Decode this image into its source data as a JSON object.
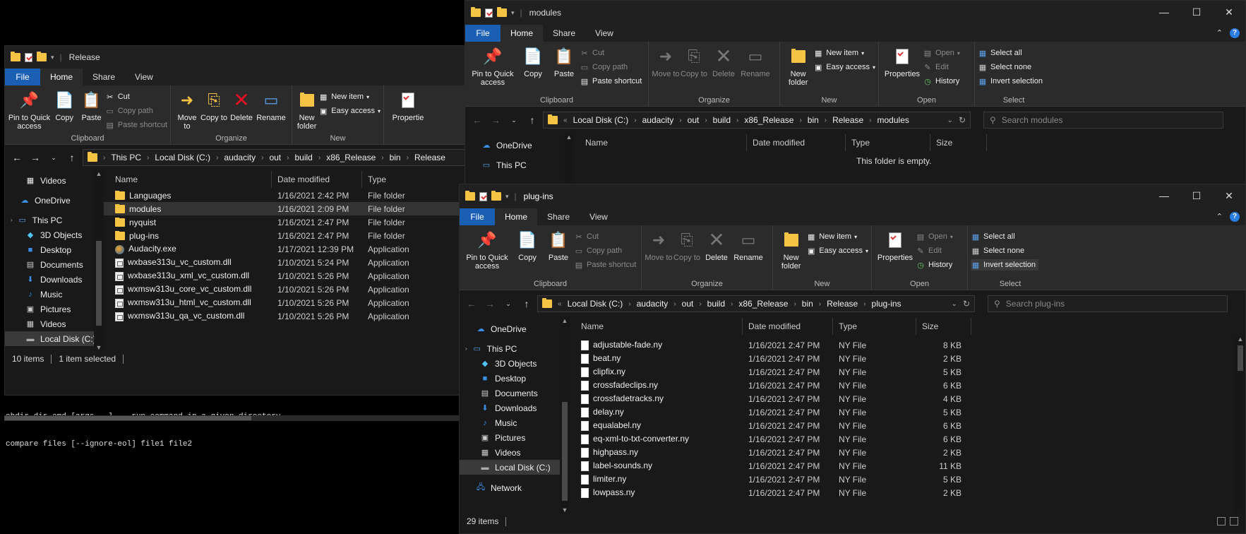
{
  "colors": {
    "file_tab": "#1a5fb4",
    "folder": "#f6c444",
    "bg": "#191919",
    "ribbon": "#2b2b2b"
  },
  "ribbon": {
    "tabs": [
      "File",
      "Home",
      "Share",
      "View"
    ],
    "clipboard": {
      "pin": "Pin to Quick access",
      "copy": "Copy",
      "paste": "Paste",
      "cut": "Cut",
      "copy_path": "Copy path",
      "paste_shortcut": "Paste shortcut",
      "label": "Clipboard"
    },
    "organize": {
      "move_to": "Move to",
      "copy_to": "Copy to",
      "delete": "Delete",
      "rename": "Rename",
      "label": "Organize"
    },
    "new": {
      "new_folder": "New folder",
      "new_item": "New item",
      "easy_access": "Easy access",
      "label": "New"
    },
    "open": {
      "properties": "Properties",
      "open": "Open",
      "edit": "Edit",
      "history": "History",
      "label": "Open",
      "properties_cut": "Propertie"
    },
    "select": {
      "select_all": "Select all",
      "select_none": "Select none",
      "invert": "Invert selection",
      "label": "Select"
    }
  },
  "columns": {
    "name": "Name",
    "date": "Date modified",
    "type": "Type",
    "size": "Size"
  },
  "release": {
    "title": "Release",
    "path": [
      "This PC",
      "Local Disk (C:)",
      "audacity",
      "out",
      "build",
      "x86_Release",
      "bin",
      "Release"
    ],
    "nav": [
      {
        "label": "Videos",
        "icon": "videos-icon"
      },
      {
        "label": "OneDrive",
        "icon": "cloud-icon"
      },
      {
        "label": "This PC",
        "icon": "pc-icon"
      },
      {
        "label": "3D Objects",
        "icon": "cube-icon"
      },
      {
        "label": "Desktop",
        "icon": "desktop-icon"
      },
      {
        "label": "Documents",
        "icon": "documents-icon"
      },
      {
        "label": "Downloads",
        "icon": "download-icon"
      },
      {
        "label": "Music",
        "icon": "music-icon"
      },
      {
        "label": "Pictures",
        "icon": "pictures-icon"
      },
      {
        "label": "Videos",
        "icon": "videos-icon"
      },
      {
        "label": "Local Disk (C:)",
        "icon": "drive-icon"
      }
    ],
    "files": [
      {
        "name": "Languages",
        "date": "1/16/2021 2:42 PM",
        "type": "File folder",
        "kind": "folder"
      },
      {
        "name": "modules",
        "date": "1/16/2021 2:09 PM",
        "type": "File folder",
        "kind": "folder"
      },
      {
        "name": "nyquist",
        "date": "1/16/2021 2:47 PM",
        "type": "File folder",
        "kind": "folder"
      },
      {
        "name": "plug-ins",
        "date": "1/16/2021 2:47 PM",
        "type": "File folder",
        "kind": "folder"
      },
      {
        "name": "Audacity.exe",
        "date": "1/17/2021 12:39 PM",
        "type": "Application",
        "kind": "exe"
      },
      {
        "name": "wxbase313u_vc_custom.dll",
        "date": "1/10/2021 5:24 PM",
        "type": "Application",
        "kind": "dll"
      },
      {
        "name": "wxbase313u_xml_vc_custom.dll",
        "date": "1/10/2021 5:26 PM",
        "type": "Application",
        "kind": "dll"
      },
      {
        "name": "wxmsw313u_core_vc_custom.dll",
        "date": "1/10/2021 5:26 PM",
        "type": "Application",
        "kind": "dll"
      },
      {
        "name": "wxmsw313u_html_vc_custom.dll",
        "date": "1/10/2021 5:26 PM",
        "type": "Application",
        "kind": "dll"
      },
      {
        "name": "wxmsw313u_qa_vc_custom.dll",
        "date": "1/10/2021 5:26 PM",
        "type": "Application",
        "kind": "dll"
      }
    ],
    "status_count": "10 items",
    "status_sel": "1 item selected"
  },
  "console": {
    "line1": "chdir dir cmd [args...]  - run command in a given directory",
    "line2": "compare files [--ignore-eol] file1 file2"
  },
  "modules": {
    "title": "modules",
    "path": [
      "Local Disk (C:)",
      "audacity",
      "out",
      "build",
      "x86_Release",
      "bin",
      "Release",
      "modules"
    ],
    "search": "Search modules",
    "nav": [
      {
        "label": "OneDrive",
        "icon": "cloud-icon"
      },
      {
        "label": "This PC",
        "icon": "pc-icon"
      }
    ],
    "empty": "This folder is empty."
  },
  "plugins": {
    "title": "plug-ins",
    "path": [
      "Local Disk (C:)",
      "audacity",
      "out",
      "build",
      "x86_Release",
      "bin",
      "Release",
      "plug-ins"
    ],
    "search": "Search plug-ins",
    "nav": [
      {
        "label": "OneDrive",
        "icon": "cloud-icon"
      },
      {
        "label": "This PC",
        "icon": "pc-icon"
      },
      {
        "label": "3D Objects",
        "icon": "cube-icon"
      },
      {
        "label": "Desktop",
        "icon": "desktop-icon"
      },
      {
        "label": "Documents",
        "icon": "documents-icon"
      },
      {
        "label": "Downloads",
        "icon": "download-icon"
      },
      {
        "label": "Music",
        "icon": "music-icon"
      },
      {
        "label": "Pictures",
        "icon": "pictures-icon"
      },
      {
        "label": "Videos",
        "icon": "videos-icon"
      },
      {
        "label": "Local Disk (C:)",
        "icon": "drive-icon"
      },
      {
        "label": "Network",
        "icon": "network-icon"
      }
    ],
    "files": [
      {
        "name": "adjustable-fade.ny",
        "date": "1/16/2021 2:47 PM",
        "type": "NY File",
        "size": "8 KB"
      },
      {
        "name": "beat.ny",
        "date": "1/16/2021 2:47 PM",
        "type": "NY File",
        "size": "2 KB"
      },
      {
        "name": "clipfix.ny",
        "date": "1/16/2021 2:47 PM",
        "type": "NY File",
        "size": "5 KB"
      },
      {
        "name": "crossfadeclips.ny",
        "date": "1/16/2021 2:47 PM",
        "type": "NY File",
        "size": "6 KB"
      },
      {
        "name": "crossfadetracks.ny",
        "date": "1/16/2021 2:47 PM",
        "type": "NY File",
        "size": "4 KB"
      },
      {
        "name": "delay.ny",
        "date": "1/16/2021 2:47 PM",
        "type": "NY File",
        "size": "5 KB"
      },
      {
        "name": "equalabel.ny",
        "date": "1/16/2021 2:47 PM",
        "type": "NY File",
        "size": "6 KB"
      },
      {
        "name": "eq-xml-to-txt-converter.ny",
        "date": "1/16/2021 2:47 PM",
        "type": "NY File",
        "size": "6 KB"
      },
      {
        "name": "highpass.ny",
        "date": "1/16/2021 2:47 PM",
        "type": "NY File",
        "size": "2 KB"
      },
      {
        "name": "label-sounds.ny",
        "date": "1/16/2021 2:47 PM",
        "type": "NY File",
        "size": "11 KB"
      },
      {
        "name": "limiter.ny",
        "date": "1/16/2021 2:47 PM",
        "type": "NY File",
        "size": "5 KB"
      },
      {
        "name": "lowpass.ny",
        "date": "1/16/2021 2:47 PM",
        "type": "NY File",
        "size": "2 KB"
      }
    ],
    "status_count": "29 items"
  }
}
